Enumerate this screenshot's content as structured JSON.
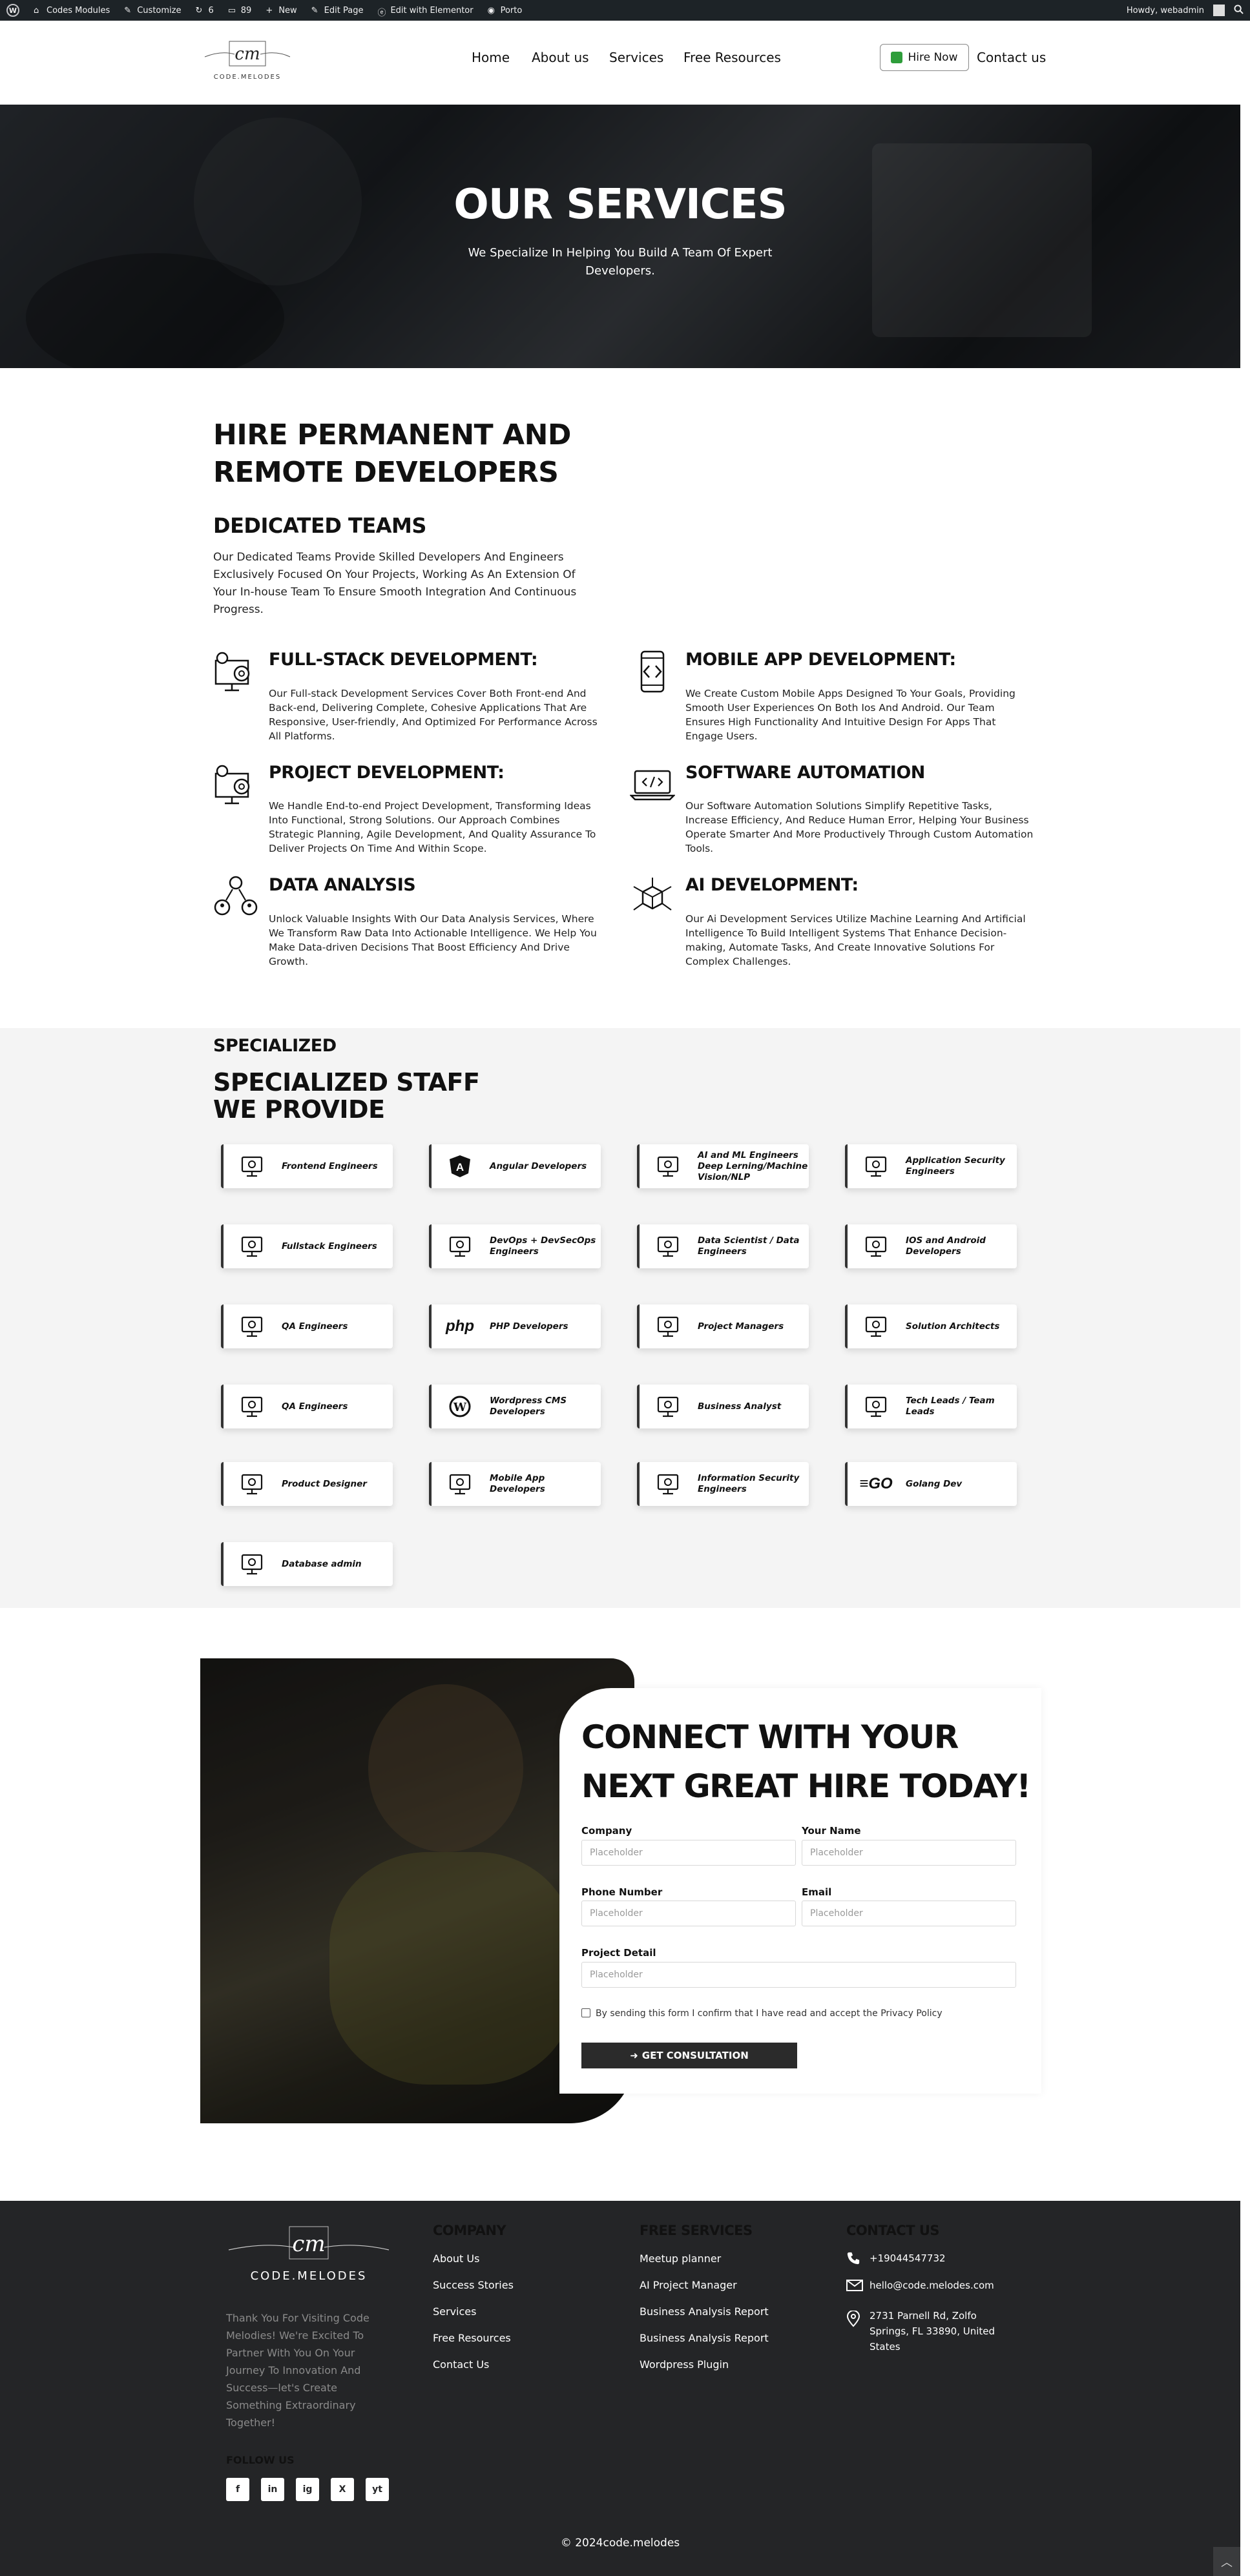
{
  "adminbar": {
    "items": [
      "Codes Modules",
      "Customize",
      "6",
      "89",
      "New",
      "Edit Page",
      "Edit with Elementor",
      "Porto"
    ],
    "howdy": "Howdy, webadmin"
  },
  "header": {
    "logo_text": "CODE.MELODES",
    "logo_mark": "cm",
    "nav": [
      "Home",
      "About us",
      "Services",
      "Free Resources"
    ],
    "hire_button": "Hire Now",
    "contact_link": "Contact us"
  },
  "hero": {
    "title": "OUR SERVICES",
    "subtitle": "We Specialize In Helping You Build A Team Of Expert Developers."
  },
  "intro": {
    "heading": "HIRE PERMANENT AND REMOTE DEVELOPERS",
    "subheading": "DEDICATED TEAMS",
    "text": "Our Dedicated Teams Provide Skilled Developers And Engineers Exclusively Focused On Your Projects, Working As An Extension Of Your In-house Team To Ensure Smooth Integration And Continuous Progress."
  },
  "services": [
    {
      "icon": "gear-monitor-icon",
      "title": "FULL-STACK DEVELOPMENT:",
      "desc": "Our Full-stack Development Services Cover Both Front-end And Back-end, Delivering Complete, Cohesive Applications That Are Responsive, User-friendly, And Optimized For Performance Across All Platforms."
    },
    {
      "icon": "mobile-code-icon",
      "title": "MOBILE APP DEVELOPMENT:",
      "desc": "We Create Custom Mobile Apps Designed To Your Goals, Providing Smooth User Experiences On Both Ios And Android. Our Team Ensures High Functionality And Intuitive Design For Apps That Engage Users."
    },
    {
      "icon": "gear-monitor-icon",
      "title": "PROJECT DEVELOPMENT:",
      "desc": "We Handle End-to-end Project Development, Transforming Ideas Into Functional, Strong Solutions. Our Approach Combines Strategic Planning, Agile Development, And Quality Assurance To Deliver Projects On Time And Within Scope."
    },
    {
      "icon": "laptop-code-icon",
      "title": "SOFTWARE AUTOMATION",
      "desc": "Our Software Automation Solutions Simplify Repetitive Tasks, Increase Efficiency, And Reduce Human Error, Helping Your Business Operate Smarter And More Productively Through Custom Automation Tools."
    },
    {
      "icon": "people-network-icon",
      "title": "DATA ANALYSIS",
      "desc": "Unlock Valuable Insights With Our Data Analysis Services, Where We Transform Raw Data Into Actionable Intelligence. We Help You Make Data-driven Decisions That Boost Efficiency And Drive Growth."
    },
    {
      "icon": "cube-network-icon",
      "title": "AI DEVELOPMENT:",
      "desc": "Our Ai Development Services Utilize Machine Learning And Artificial Intelligence To Build Intelligent Systems That Enhance Decision-making, Automate Tasks, And Create Innovative Solutions For Complex Challenges."
    }
  ],
  "specialized": {
    "eyebrow": "SPECIALIZED",
    "heading": "SPECIALIZED STAFF WE PROVIDE",
    "staff": [
      {
        "label": "Frontend Engineers",
        "icon": "monitor-code-icon"
      },
      {
        "label": "Angular Developers",
        "icon": "angular-icon"
      },
      {
        "label": "AI and ML Engineers Deep Lerning/Machine Vision/NLP",
        "icon": "ai-chip-icon"
      },
      {
        "label": "Application Security Engineers",
        "icon": "shield-monitor-icon"
      },
      {
        "label": "Fullstack Engineers",
        "icon": "monitor-gear-icon"
      },
      {
        "label": "DevOps + DevSecOps Engineers",
        "icon": "devops-cycle-icon"
      },
      {
        "label": "Data Scientist / Data Engineers",
        "icon": "atom-icon"
      },
      {
        "label": "IOS and Android Developers",
        "icon": "mobile-apps-icon"
      },
      {
        "label": "QA Engineers",
        "icon": "qa-monitor-icon"
      },
      {
        "label": "PHP Developers",
        "icon": "php-icon"
      },
      {
        "label": "Project Managers",
        "icon": "manager-badge-icon"
      },
      {
        "label": "Solution Architects",
        "icon": "network-nodes-icon"
      },
      {
        "label": "QA Engineers",
        "icon": "qa-monitor-icon"
      },
      {
        "label": "Wordpress CMS Developers",
        "icon": "wordpress-icon"
      },
      {
        "label": "Business Analyst",
        "icon": "magnifier-chart-icon"
      },
      {
        "label": "Tech Leads / Team Leads",
        "icon": "team-lead-icon"
      },
      {
        "label": "Product Designer",
        "icon": "head-gear-icon"
      },
      {
        "label": "Mobile App Developers",
        "icon": "mobile-icon"
      },
      {
        "label": "Information Security Engineers",
        "icon": "lock-shield-icon"
      },
      {
        "label": "Golang Dev",
        "icon": "golang-icon"
      },
      {
        "label": "Database admin",
        "icon": "database-icon"
      }
    ]
  },
  "contact": {
    "title_line1": "CONNECT WITH YOUR",
    "title_line2": "NEXT GREAT HIRE TODAY!",
    "fields": {
      "company": {
        "label": "Company",
        "placeholder": "Placeholder"
      },
      "name": {
        "label": "Your Name",
        "placeholder": "Placeholder"
      },
      "phone": {
        "label": "Phone Number",
        "placeholder": "Placeholder"
      },
      "email": {
        "label": "Email",
        "placeholder": "Placeholder"
      },
      "project": {
        "label": "Project Detail",
        "placeholder": "Placeholder"
      }
    },
    "consent": "By sending this form I confirm that I have read and accept the Privacy Policy",
    "submit": "GET CONSULTATION"
  },
  "footer": {
    "logo_text": "CODE.MELODES",
    "logo_mark": "cm",
    "about": "Thank You For Visiting Code Melodies! We're Excited To Partner With You On Your Journey To Innovation And Success—let's Create Something Extraordinary Together!",
    "follow": "FOLLOW US",
    "social": [
      "f",
      "in",
      "ig",
      "X",
      "yt"
    ],
    "company_head": "COMPANY",
    "company_links": [
      "About Us",
      "Success Stories",
      "Services",
      "Free Resources",
      "Contact Us"
    ],
    "free_head": "FREE SERVICES",
    "free_links": [
      "Meetup planner",
      "AI Project Manager",
      "Business Analysis Report",
      "Business Analysis Report",
      "Wordpress Plugin"
    ],
    "contact_head": "CONTACT US",
    "phone": "+19044547732",
    "email": "hello@code.melodes.com",
    "address": "2731 Parnell Rd, Zolfo Springs, FL 33890, United States",
    "copyright": "© 2024code.melodes"
  }
}
